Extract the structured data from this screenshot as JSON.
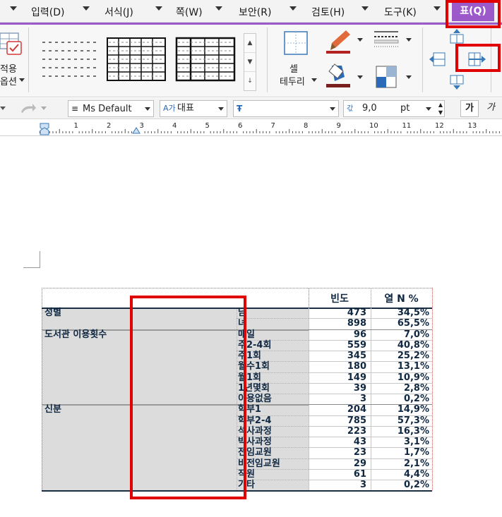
{
  "menu": {
    "items": [
      "입력(D)",
      "서식(J)",
      "쪽(W)",
      "보안(R)",
      "검토(H)",
      "도구(K)"
    ],
    "active_item": "표(Q)",
    "active_color": "#9b59c9"
  },
  "ribbon": {
    "apply_label_line1": "적용",
    "apply_label_line2": "옵션",
    "cell_border_label_line1": "셀",
    "cell_border_label_line2": "테두리"
  },
  "format_bar": {
    "style_value": "Ms Default",
    "font_value": "대표",
    "size_value": "9,0",
    "size_unit": "pt",
    "bold_label": "가",
    "italic_label": "가"
  },
  "ruler": {
    "numbers": [
      "1",
      "2",
      "3",
      "4",
      "5",
      "6",
      "7",
      "8",
      "9",
      "10",
      "11",
      "12",
      "13"
    ]
  },
  "table": {
    "headers": [
      "빈도",
      "열 N %"
    ],
    "groups": [
      {
        "name": "성별",
        "rows": [
          {
            "cat": "남",
            "freq": "473",
            "pct": "34,5%"
          },
          {
            "cat": "녀",
            "freq": "898",
            "pct": "65,5%"
          }
        ]
      },
      {
        "name": "도서관 이용횟수",
        "rows": [
          {
            "cat": "매일",
            "freq": "96",
            "pct": "7,0%"
          },
          {
            "cat": "주2-4회",
            "freq": "559",
            "pct": "40,8%"
          },
          {
            "cat": "주1회",
            "freq": "345",
            "pct": "25,2%"
          },
          {
            "cat": "월수1회",
            "freq": "180",
            "pct": "13,1%"
          },
          {
            "cat": "월1회",
            "freq": "149",
            "pct": "10,9%"
          },
          {
            "cat": "1년몇회",
            "freq": "39",
            "pct": "2,8%"
          },
          {
            "cat": "이용없음",
            "freq": "3",
            "pct": "0,2%"
          }
        ]
      },
      {
        "name": "신분",
        "rows": [
          {
            "cat": "학부1",
            "freq": "204",
            "pct": "14,9%"
          },
          {
            "cat": "학부2-4",
            "freq": "785",
            "pct": "57,3%"
          },
          {
            "cat": "석사과정",
            "freq": "223",
            "pct": "16,3%"
          },
          {
            "cat": "박사과정",
            "freq": "43",
            "pct": "3,1%"
          },
          {
            "cat": "전임교원",
            "freq": "23",
            "pct": "1,7%"
          },
          {
            "cat": "비전임교원",
            "freq": "29",
            "pct": "2,1%"
          },
          {
            "cat": "직원",
            "freq": "61",
            "pct": "4,4%"
          },
          {
            "cat": "기타",
            "freq": "3",
            "pct": "0,2%"
          }
        ]
      }
    ]
  },
  "colors": {
    "highlight": "#e00000",
    "table_text": "#0f2740",
    "cell_fill": "#dcdcdc"
  }
}
